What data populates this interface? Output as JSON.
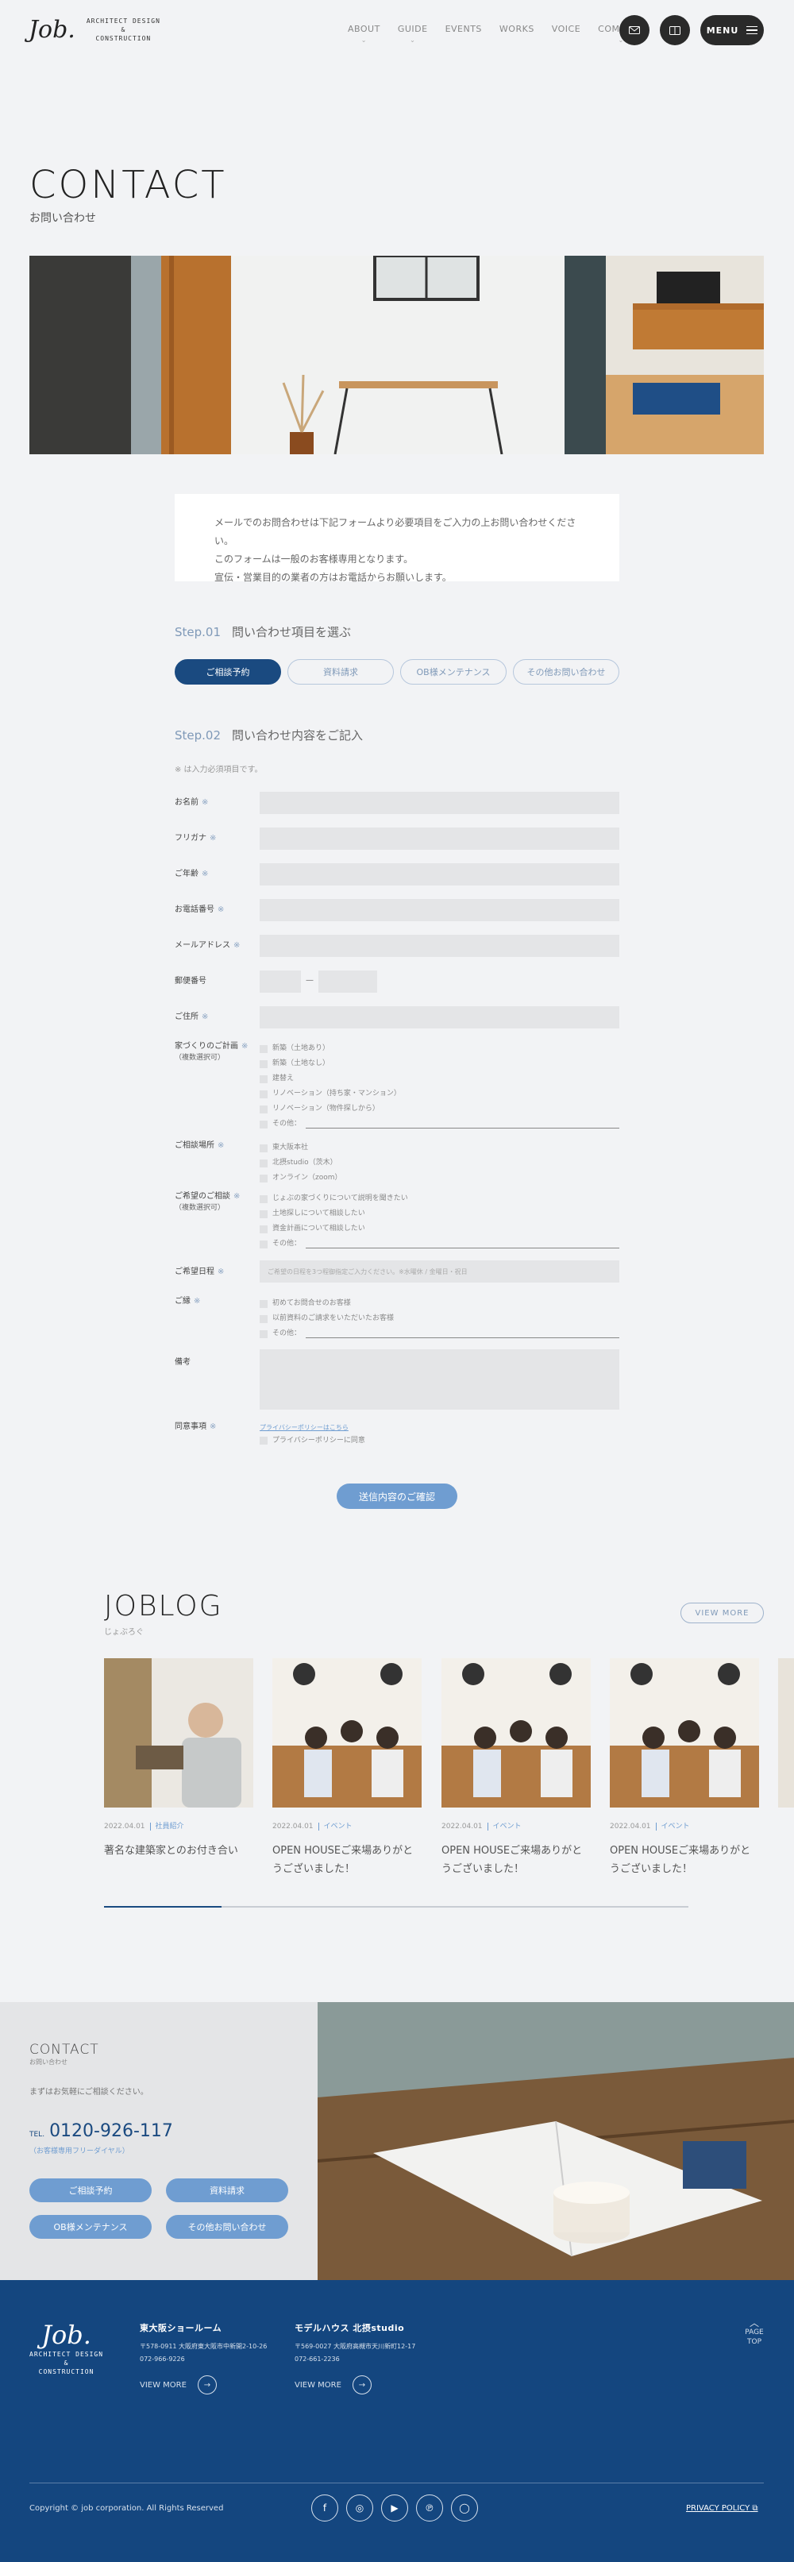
{
  "header": {
    "logo_mark": "Job.",
    "logo_line1": "ARCHITECT DESIGN",
    "logo_line2": "&",
    "logo_line3": "CONSTRUCTION",
    "nav": [
      "ABOUT",
      "GUIDE",
      "EVENTS",
      "WORKS",
      "VOICE",
      "COMPANY"
    ],
    "menu_label": "MENU"
  },
  "page": {
    "title": "CONTACT",
    "subtitle": "お問い合わせ"
  },
  "intro": [
    "メールでのお問合わせは下記フォームより必要項目をご入力の上お問い合わせください。",
    "このフォームは一般のお客様専用となります。",
    "宣伝・営業目的の業者の方はお電話からお願いします。"
  ],
  "step1": {
    "num": "Step.01",
    "label": "問い合わせ項目を選ぶ",
    "tabs": [
      "ご相談予約",
      "資料請求",
      "OB様メンテナンス",
      "その他お問い合わせ"
    ]
  },
  "step2": {
    "num": "Step.02",
    "label": "問い合わせ内容をご記入"
  },
  "form": {
    "required_note": "※ は入力必須項目です。",
    "mark": "※",
    "dash": "—",
    "name": "お名前",
    "kana": "フリガナ",
    "age": "ご年齢",
    "phone": "お電話番号",
    "email": "メールアドレス",
    "zip": "郵便番号",
    "address": "ご住所",
    "plan": "家づくりのご計画",
    "plan_sub": "（複数選択可）",
    "plan_opts": [
      "新築（土地あり）",
      "新築（土地なし）",
      "建替え",
      "リノベーション（持ち家・マンション）",
      "リノベーション（物件探しから）",
      "その他："
    ],
    "place": "ご相談場所",
    "place_opts": [
      "東大阪本社",
      "北摂studio（茨木）",
      "オンライン（zoom）"
    ],
    "want": "ご希望のご相談",
    "want_sub": "（複数選択可）",
    "want_opts": [
      "じょぶの家づくりについて説明を聞きたい",
      "土地探しについて相談したい",
      "資金計画について相談したい",
      "その他："
    ],
    "date": "ご希望日程",
    "date_placeholder": "ご希望の日程を3つ程御指定ご入力ください。※水曜休 / 金曜日・祝日",
    "status": "ご縁",
    "status_opts": [
      "初めてお問合せのお客様",
      "以前資料のご請求をいただいたお客様",
      "その他："
    ],
    "note": "備考",
    "agree": "同意事項",
    "policy_link": "プライバシーポリシーはこちら",
    "agree_opt": "プライバシーポリシーに同意",
    "confirm": "送信内容のご確認"
  },
  "blog": {
    "title": "JOBLOG",
    "subtitle": "じょぶろぐ",
    "view_more": "VIEW MORE",
    "posts": [
      {
        "date": "2022.04.01",
        "cat": "社員紹介",
        "title": "著名な建築家とのお付き合い"
      },
      {
        "date": "2022.04.01",
        "cat": "イベント",
        "title": "OPEN HOUSEご来場ありがとうございました！"
      },
      {
        "date": "2022.04.01",
        "cat": "イベント",
        "title": "OPEN HOUSEご来場ありがとうございました！"
      },
      {
        "date": "2022.04.01",
        "cat": "イベント",
        "title": "OPEN HOUSEご来場ありがとうございました！"
      }
    ]
  },
  "contact_box": {
    "title": "CONTACT",
    "subtitle": "お問い合わせ",
    "text": "まずはお気軽にご相談ください。",
    "tel_label": "TEL.",
    "tel": "0120-926-117",
    "tel_note": "（お客様専用フリーダイヤル）",
    "buttons": [
      "ご相談予約",
      "資料請求",
      "OB様メンテナンス",
      "その他お問い合わせ"
    ]
  },
  "footer": {
    "col1": {
      "title": "東大阪ショールーム",
      "addr": "〒578-0911 大阪府東大阪市中新開2-10-26",
      "tel": "072-966-9226",
      "more": "VIEW MORE"
    },
    "col2": {
      "title": "モデルハウス 北摂studio",
      "addr": "〒569-0027 大阪府高槻市天川新町12-17",
      "tel": "072-661-2236",
      "more": "VIEW MORE"
    },
    "page_top": "PAGE TOP",
    "copyright": "Copyright © job corporation. All Rights Reserved",
    "privacy": "PRIVACY POLICY"
  }
}
